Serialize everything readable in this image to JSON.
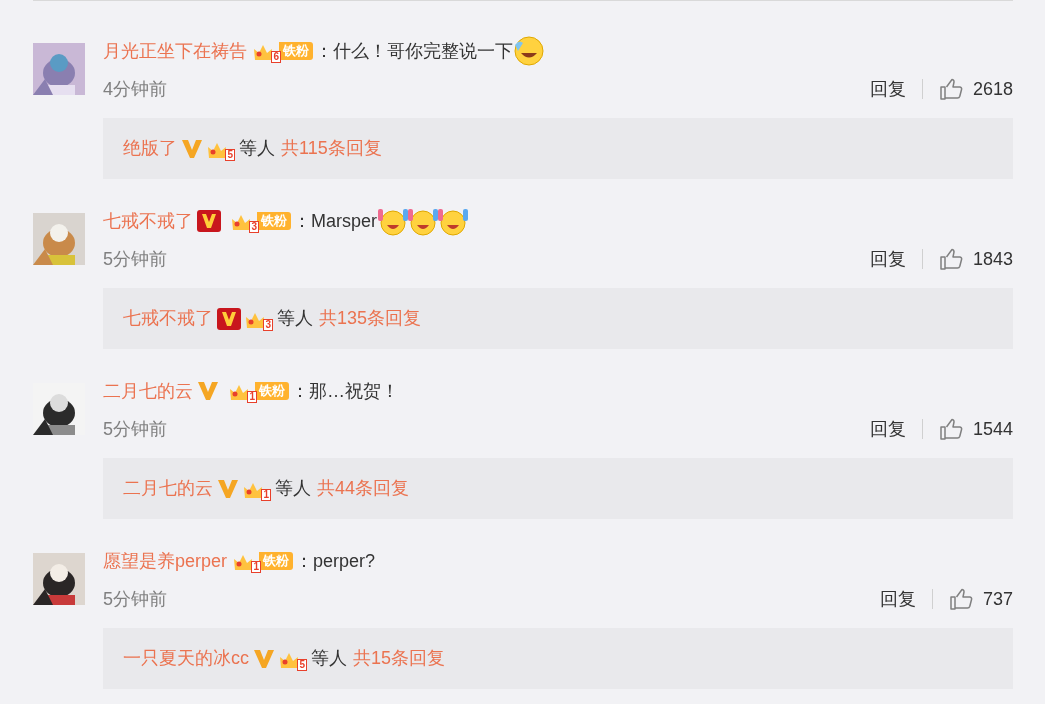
{
  "comments": [
    {
      "avatar": {
        "kind": "picture"
      },
      "name": "月光正坐下在祷告",
      "fan_badge": {
        "rank": "6",
        "label": "铁粉"
      },
      "separator": "：",
      "text": "什么！哥你完整说一下",
      "emojis": [
        {
          "kind": "cry-laugh"
        }
      ],
      "time": "4分钟前",
      "reply_label": "回复",
      "likes": "2618",
      "replies": {
        "names": [
          {
            "name": "绝版了",
            "verified_badge": {
              "kind": "gold"
            },
            "rank": "5"
          }
        ],
        "suffix": "等人",
        "count_text": "共115条回复"
      }
    },
    {
      "avatar": {
        "kind": "picture"
      },
      "name": "七戒不戒了",
      "verified_badge": {
        "kind": "red"
      },
      "fan_badge": {
        "rank": "3",
        "label": "铁粉"
      },
      "separator": "：",
      "text": "Marsper",
      "emojis": [
        {
          "kind": "cheer"
        },
        {
          "kind": "cheer"
        },
        {
          "kind": "cheer"
        }
      ],
      "time": "5分钟前",
      "reply_label": "回复",
      "likes": "1843",
      "replies": {
        "names": [
          {
            "name": "七戒不戒了",
            "verified_badge": {
              "kind": "red"
            },
            "rank": "3"
          }
        ],
        "suffix": "等人",
        "count_text": "共135条回复"
      }
    },
    {
      "avatar": {
        "kind": "picture"
      },
      "name": "二月七的云",
      "verified_badge": {
        "kind": "gold"
      },
      "fan_badge": {
        "rank": "1",
        "label": "铁粉"
      },
      "separator": "：",
      "text": "那…祝贺！",
      "time": "5分钟前",
      "reply_label": "回复",
      "likes": "1544",
      "replies": {
        "names": [
          {
            "name": "二月七的云",
            "verified_badge": {
              "kind": "gold"
            },
            "rank": "1"
          }
        ],
        "suffix": "等人",
        "count_text": "共44条回复"
      }
    },
    {
      "avatar": {
        "kind": "picture"
      },
      "name": "愿望是养perper",
      "fan_badge": {
        "rank": "1",
        "label": "铁粉"
      },
      "separator": "：",
      "text": "perper?",
      "time": "5分钟前",
      "reply_label": "回复",
      "likes": "737",
      "replies": {
        "names": [
          {
            "name": "一只夏天的冰cc",
            "verified_badge": {
              "kind": "gold"
            },
            "rank": "5"
          }
        ],
        "suffix": "等人",
        "count_text": "共15条回复"
      }
    }
  ]
}
